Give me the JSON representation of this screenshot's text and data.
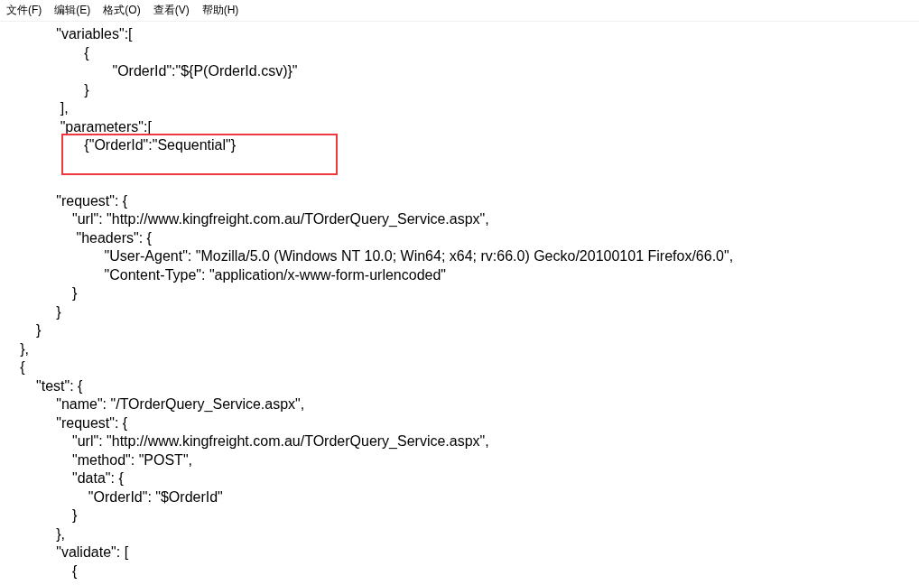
{
  "menu_bar": [
    {
      "label": "文件(F)"
    },
    {
      "label": "编辑(E)"
    },
    {
      "label": "格式(O)"
    },
    {
      "label": "查看(V)"
    },
    {
      "label": "帮助(H)"
    }
  ],
  "editor": {
    "blocks": [
      {
        "kind": "plain",
        "lines": [
          "              \"variables\":[",
          "                     {",
          "                            \"OrderId\":\"${P(OrderId.csv)}\"",
          "                     }",
          "               ],",
          "               \"parameters\":["
        ]
      },
      {
        "kind": "highlight",
        "lines": [
          "                     {\"OrderId\":\"Sequential\"}"
        ]
      },
      {
        "kind": "gap"
      },
      {
        "kind": "plain",
        "lines": [
          "              \"request\": {",
          "                  \"url\": \"http://www.kingfreight.com.au/TOrderQuery_Service.aspx\",",
          "                   \"headers\": {",
          "                          \"User-Agent\": \"Mozilla/5.0 (Windows NT 10.0; Win64; x64; rv:66.0) Gecko/20100101 Firefox/66.0\",",
          "                          \"Content-Type\": \"application/x-www-form-urlencoded\"",
          "                  }",
          "              }",
          "         }",
          "     },",
          "     {",
          "         \"test\": {",
          "              \"name\": \"/TOrderQuery_Service.aspx\",",
          "              \"request\": {",
          "                  \"url\": \"http://www.kingfreight.com.au/TOrderQuery_Service.aspx\",",
          "                  \"method\": \"POST\",",
          "                  \"data\": {",
          "                      \"OrderId\": \"$OrderId\"",
          "                  }",
          "              },",
          "              \"validate\": [",
          "                  {"
        ]
      }
    ]
  }
}
